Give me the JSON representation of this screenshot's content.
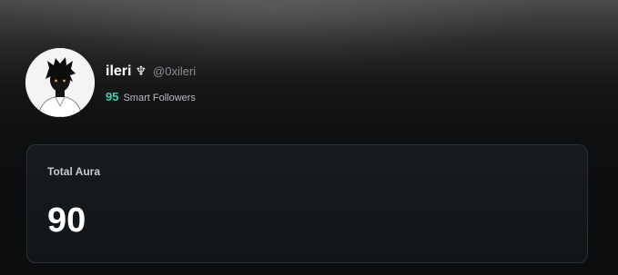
{
  "profile": {
    "display_name": "ileri",
    "name_glyph": "♆",
    "handle": "@0xileri",
    "smart_followers_count": "95",
    "smart_followers_label": "Smart Followers",
    "avatar": "anime-character-avatar"
  },
  "aura": {
    "title": "Total Aura",
    "value": "90"
  },
  "colors": {
    "accent_teal": "#3fd0b0",
    "background": "#0e0f10",
    "card": "#151a1b"
  }
}
